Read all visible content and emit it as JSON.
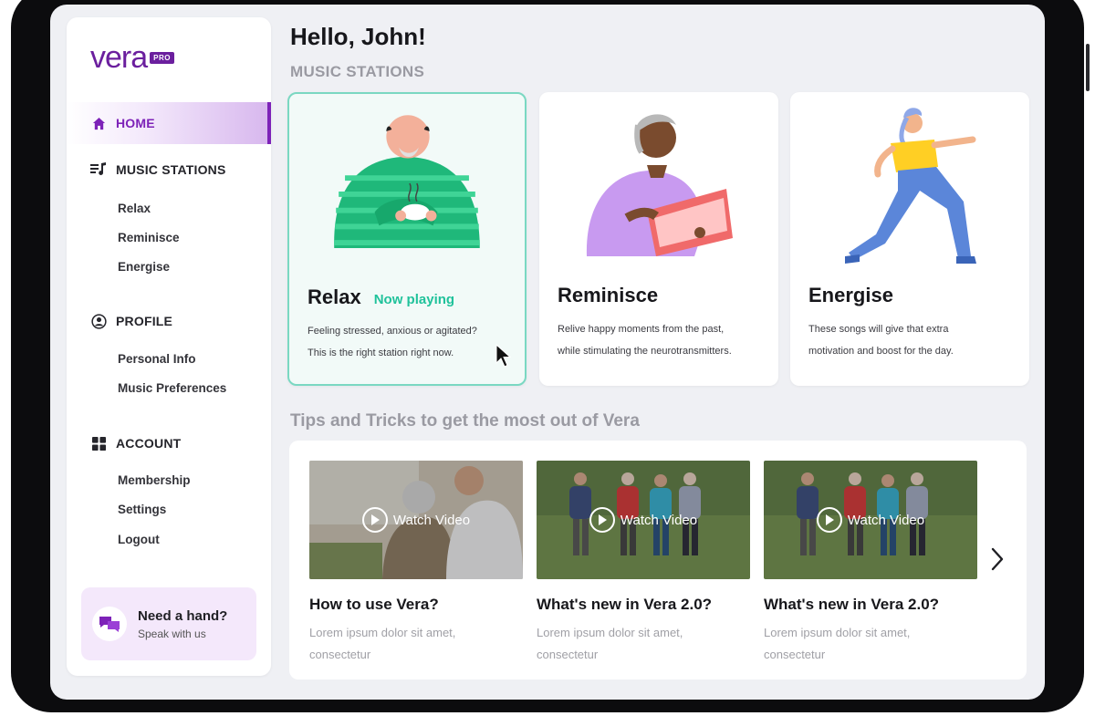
{
  "app": {
    "logo_text": "vera",
    "logo_badge": "PRO"
  },
  "sidebar": {
    "home_label": "HOME",
    "music_stations": {
      "label": "MUSIC STATIONS",
      "items": [
        "Relax",
        "Reminisce",
        "Energise"
      ]
    },
    "profile": {
      "label": "PROFILE",
      "items": [
        "Personal Info",
        "Music Preferences"
      ]
    },
    "account": {
      "label": "ACCOUNT",
      "items": [
        "Membership",
        "Settings",
        "Logout"
      ]
    },
    "help": {
      "title": "Need a hand?",
      "subtitle": "Speak with us"
    }
  },
  "main": {
    "greeting": "Hello, John!",
    "stations_title": "MUSIC STATIONS",
    "stations": [
      {
        "name": "Relax",
        "status": "Now playing",
        "desc1": "Feeling stressed, anxious or agitated?",
        "desc2": "This is the right station right now."
      },
      {
        "name": "Reminisce",
        "desc1": "Relive happy moments from the past,",
        "desc2": "while stimulating the neurotransmitters."
      },
      {
        "name": "Energise",
        "desc1": "These songs will give that extra",
        "desc2": "motivation and boost for the day."
      }
    ],
    "tips_title": "Tips and Tricks to get the most out of Vera",
    "videos": [
      {
        "watch_label": "Watch Video",
        "title": "How to use Vera?",
        "desc1": "Lorem ipsum dolor sit amet,",
        "desc2": "consectetur"
      },
      {
        "watch_label": "Watch Video",
        "title": "What's new in Vera 2.0?",
        "desc1": "Lorem ipsum dolor sit amet,",
        "desc2": "consectetur"
      },
      {
        "watch_label": "Watch Video",
        "title": "What's new in Vera 2.0?",
        "desc1": "Lorem ipsum dolor sit amet,",
        "desc2": "consectetur"
      }
    ]
  },
  "colors": {
    "brand": "#6b1f9e",
    "accent_green": "#20c29b",
    "active_border": "#7ad8c2"
  },
  "icons": [
    "home-icon",
    "music-note-icon",
    "profile-icon",
    "grid-icon",
    "chat-bubbles-icon",
    "play-icon",
    "chevron-right-icon",
    "cursor-icon"
  ]
}
